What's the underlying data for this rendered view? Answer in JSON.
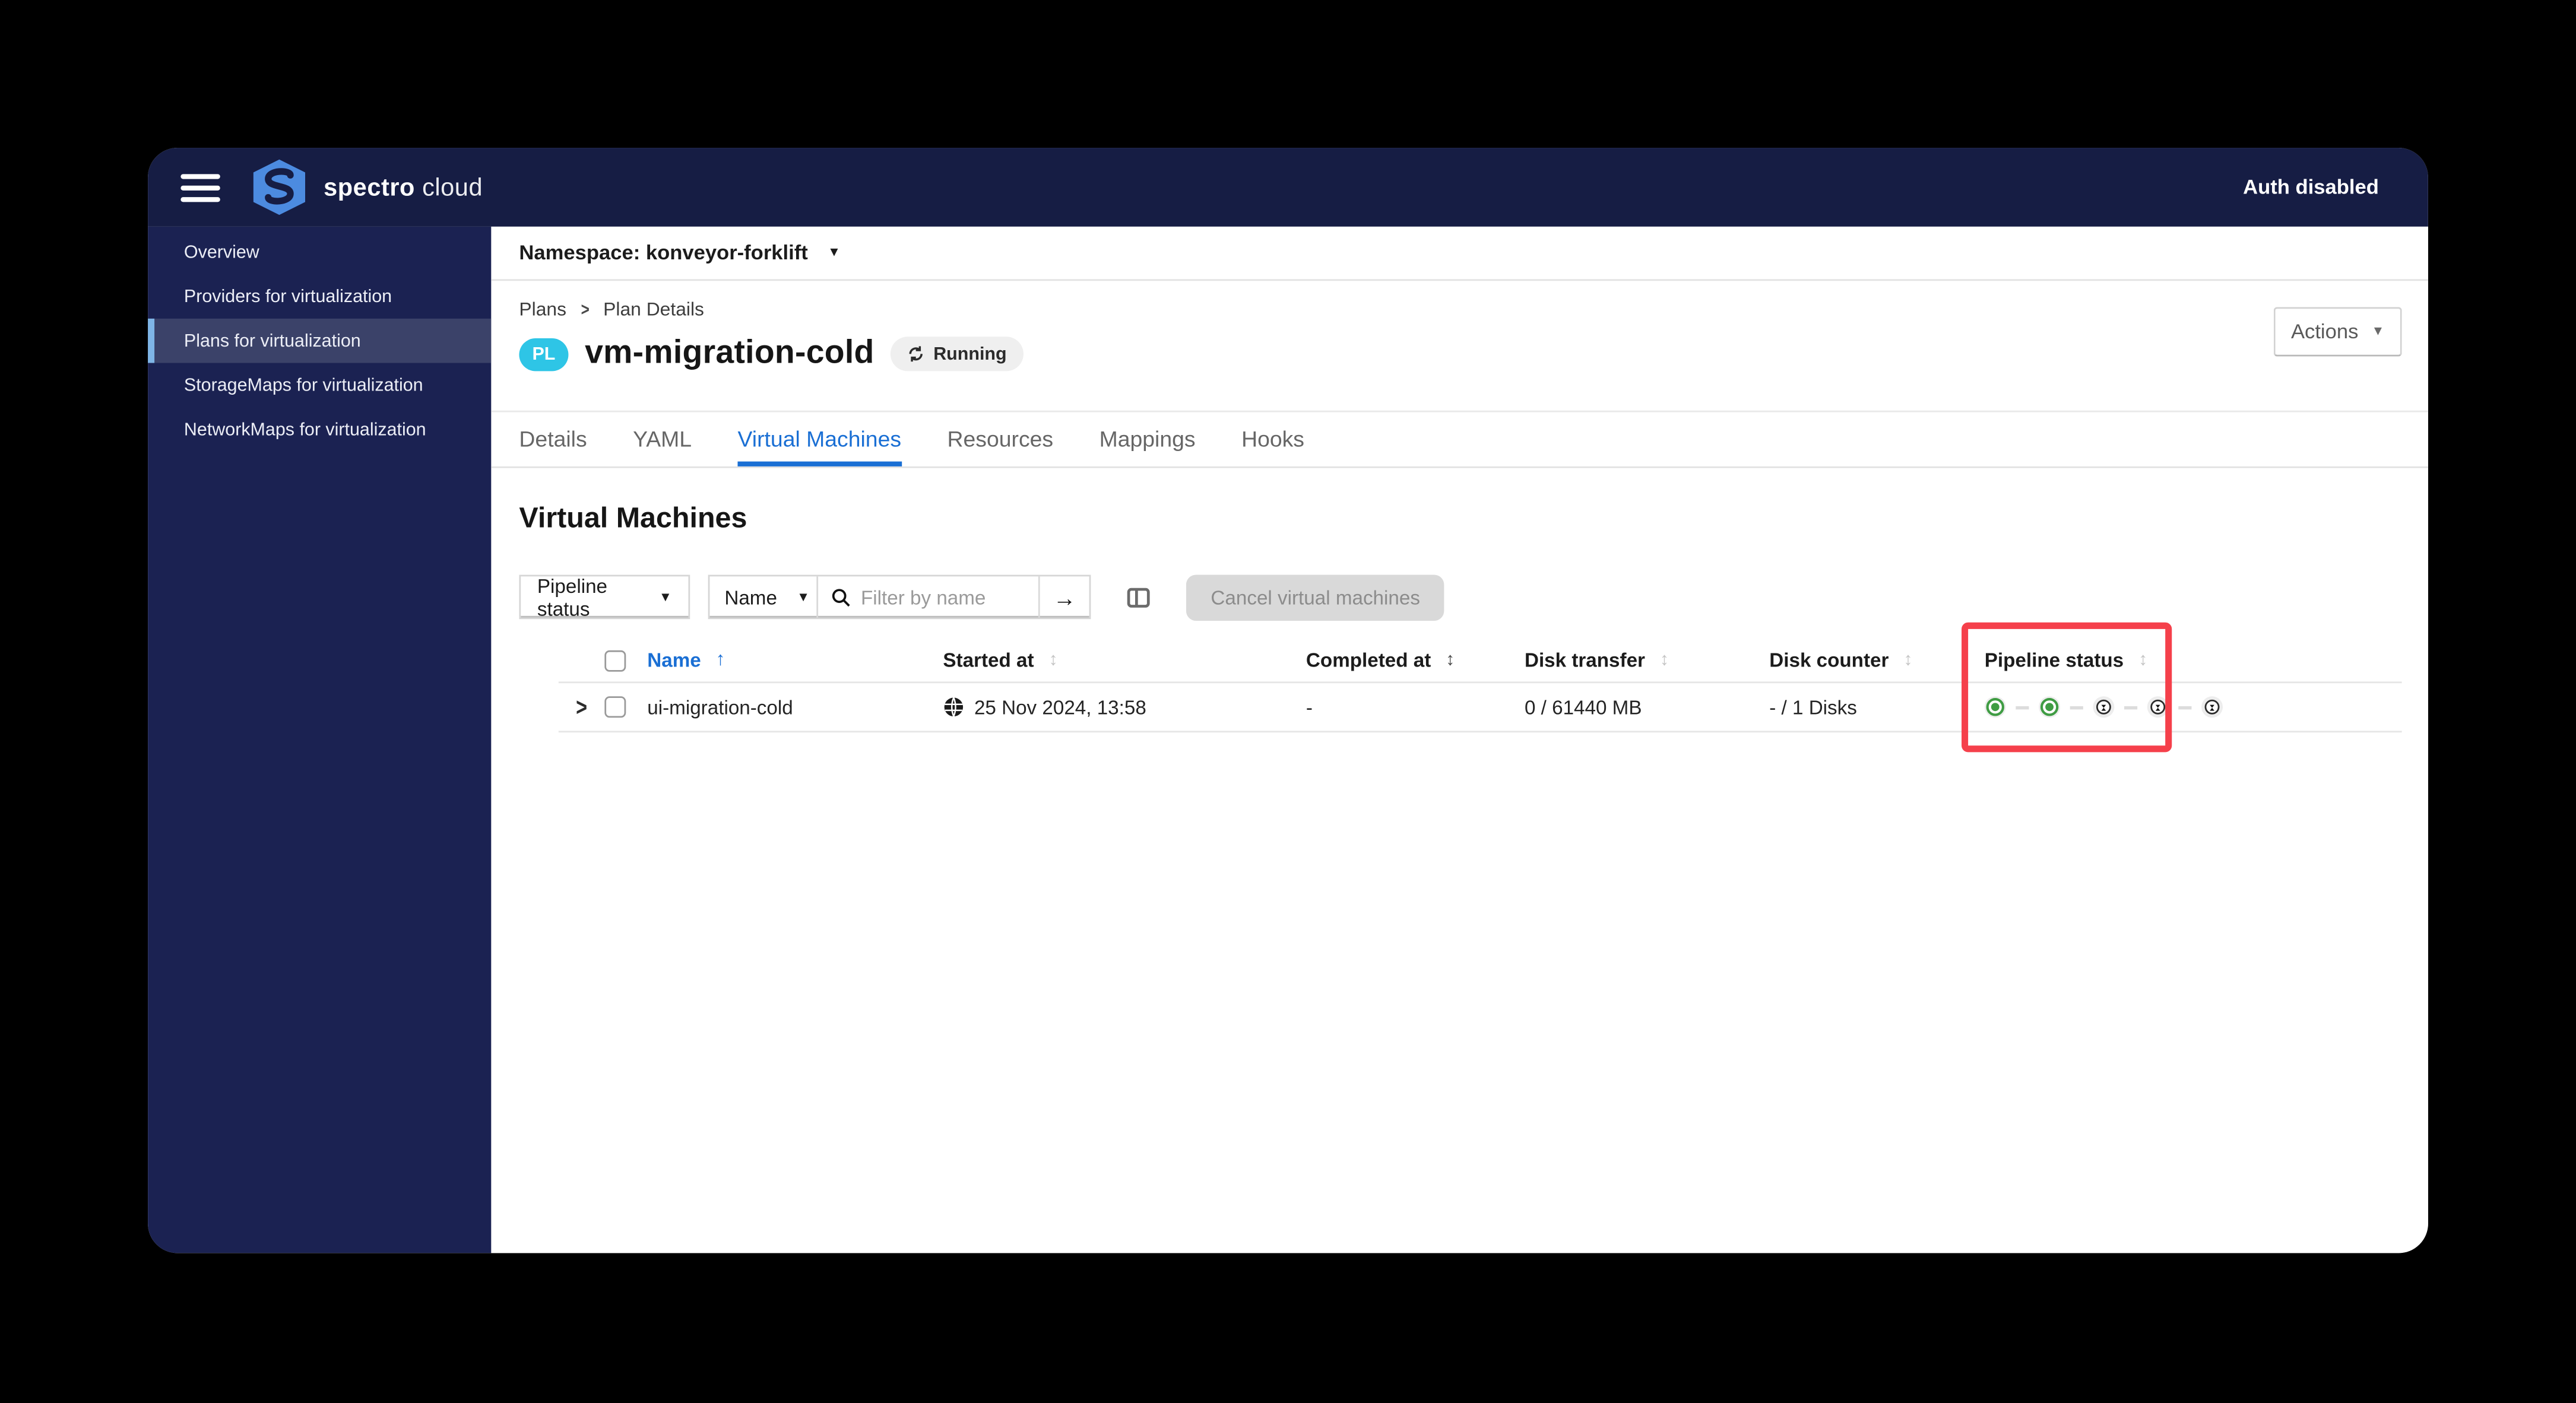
{
  "topbar": {
    "brand_primary": "spectro",
    "brand_secondary": "cloud",
    "auth_status": "Auth disabled"
  },
  "sidebar": {
    "items": [
      {
        "label": "Overview",
        "active": false
      },
      {
        "label": "Providers for virtualization",
        "active": false
      },
      {
        "label": "Plans for virtualization",
        "active": true
      },
      {
        "label": "StorageMaps for virtualization",
        "active": false
      },
      {
        "label": "NetworkMaps for virtualization",
        "active": false
      }
    ]
  },
  "namespace_bar": {
    "label": "Namespace: konveyor-forklift"
  },
  "plan_header": {
    "breadcrumb": {
      "parent": "Plans",
      "current": "Plan Details"
    },
    "badge": "PL",
    "title": "vm-migration-cold",
    "status": "Running",
    "actions_label": "Actions"
  },
  "tabs": [
    {
      "label": "Details",
      "active": false
    },
    {
      "label": "YAML",
      "active": false
    },
    {
      "label": "Virtual Machines",
      "active": true
    },
    {
      "label": "Resources",
      "active": false
    },
    {
      "label": "Mappings",
      "active": false
    },
    {
      "label": "Hooks",
      "active": false
    }
  ],
  "vm_section": {
    "title": "Virtual Machines",
    "filters": {
      "status_select": "Pipeline status",
      "field_select": "Name",
      "search_placeholder": "Filter by name",
      "cancel_button": "Cancel virtual machines"
    },
    "table": {
      "columns": [
        "Name",
        "Started at",
        "Completed at",
        "Disk transfer",
        "Disk counter",
        "Pipeline status"
      ],
      "sort": {
        "column": "Name",
        "direction": "asc"
      },
      "rows": [
        {
          "name": "ui-migration-cold",
          "started_at": "25 Nov 2024, 13:58",
          "completed_at": "-",
          "disk_transfer": "0 / 61440 MB",
          "disk_counter": "- / 1 Disks",
          "pipeline_steps": [
            "done",
            "done",
            "pending",
            "pending",
            "pending"
          ]
        }
      ]
    }
  },
  "annotation": {
    "highlighted_column": "Pipeline status",
    "highlight_color": "#f5404b"
  },
  "colors": {
    "topbar_navy": "#161d44",
    "sidebar_navy": "#1b2252",
    "active_item_bg": "#3b4269",
    "active_item_border": "#7fb5e6",
    "brand_blue": "#4c8be0",
    "badge_cyan": "#2ec5e6",
    "link_blue": "#1a6fd4",
    "success_green": "#3f9c43",
    "highlight_red": "#f5404b"
  }
}
